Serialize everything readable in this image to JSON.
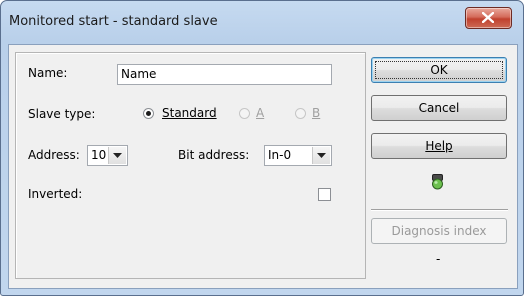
{
  "window": {
    "title": "Monitored start - standard slave"
  },
  "form": {
    "name_label": "Name:",
    "name_value": "Name",
    "slave_type_label": "Slave type:",
    "slave_types": [
      {
        "label": "Standard",
        "selected": true,
        "enabled": true
      },
      {
        "label": "A",
        "selected": false,
        "enabled": false
      },
      {
        "label": "B",
        "selected": false,
        "enabled": false
      }
    ],
    "address_label": "Address:",
    "address_value": "10",
    "bit_address_label": "Bit address:",
    "bit_address_value": "In-0",
    "inverted_label": "Inverted:",
    "inverted_checked": false
  },
  "buttons": {
    "ok": "OK",
    "cancel": "Cancel",
    "help": "Help",
    "diagnosis_index": "Diagnosis index"
  },
  "status": {
    "indicator_icon": "green-led-icon",
    "diagnosis_value": "-"
  },
  "colors": {
    "led_top": "#5a5a5a",
    "led_bottom": "#5fbf4a"
  }
}
